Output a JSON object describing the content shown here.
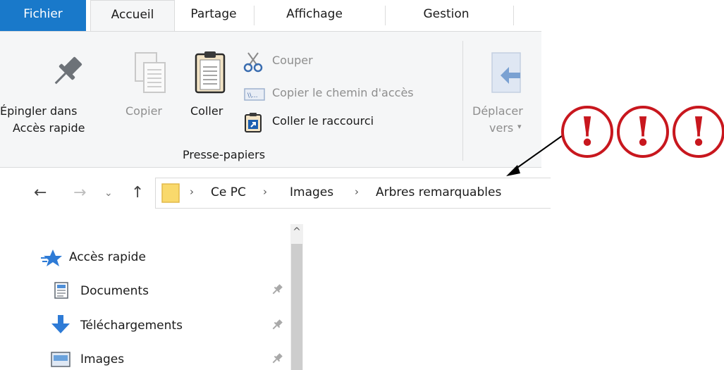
{
  "tabs": {
    "fichier": "Fichier",
    "accueil": "Accueil",
    "partage": "Partage",
    "affichage": "Affichage",
    "gestion": "Gestion"
  },
  "ribbon": {
    "pin_line1": "Épingler dans",
    "pin_line2": "Accès rapide",
    "copy": "Copier",
    "paste": "Coller",
    "cut": "Couper",
    "copy_path": "Copier le chemin d'accès",
    "paste_shortcut": "Coller le raccourci",
    "group_label": "Presse-papiers",
    "move_line1": "Déplacer",
    "move_line2": "vers"
  },
  "address": {
    "crumbs": [
      "Ce PC",
      "Images",
      "Arbres remarquables"
    ]
  },
  "nav_pane": {
    "quick_access": "Accès rapide",
    "items": [
      "Documents",
      "Téléchargements",
      "Images"
    ]
  },
  "annotation": {
    "marks": [
      "!",
      "!",
      "!"
    ],
    "color": "#c8171e"
  },
  "colors": {
    "file_tab": "#1979ca",
    "ribbon_bg": "#f5f6f7"
  }
}
